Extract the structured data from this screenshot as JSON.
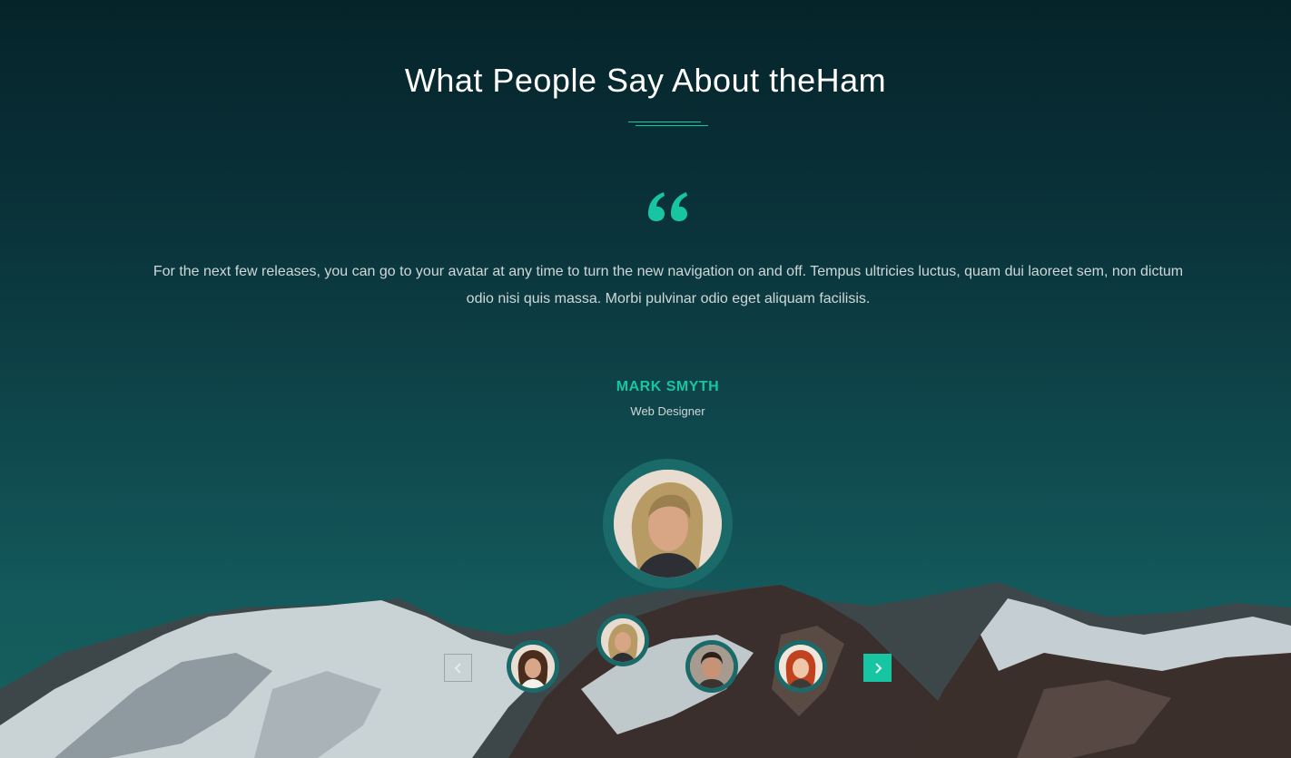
{
  "section": {
    "title": "What People Say About theHam",
    "quote": "For the next few releases, you can go to your avatar at any time to turn the new navigation on and off. Tempus ultricies luctus, quam dui laoreet sem, non dictum odio nisi quis massa. Morbi pulvinar odio eget aliquam facilisis."
  },
  "author": {
    "name": "MARK SMYTH",
    "role": "Web Designer"
  },
  "carousel": {
    "prev_icon": "chevron-left-icon",
    "next_icon": "chevron-right-icon",
    "thumbnails": [
      {
        "name": "thumb-woman-brunette"
      },
      {
        "name": "thumb-man-blond",
        "active": true
      },
      {
        "name": "thumb-man-dark"
      },
      {
        "name": "thumb-woman-redhead"
      }
    ]
  },
  "colors": {
    "accent": "#18c5a2",
    "ring": "#1b6a6a",
    "background": "#0b3034"
  }
}
